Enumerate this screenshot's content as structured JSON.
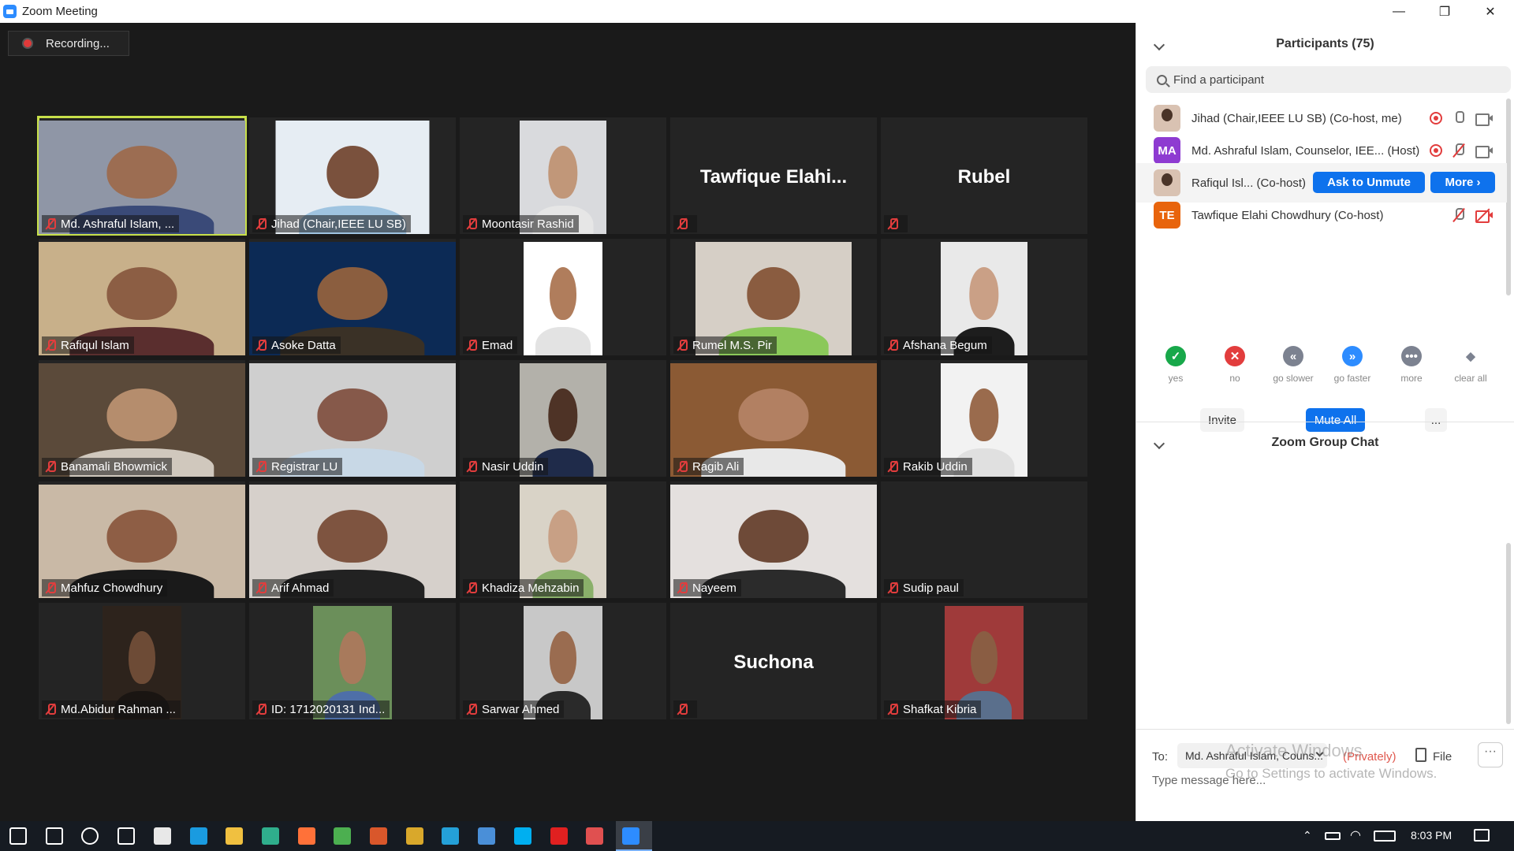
{
  "window": {
    "title": "Zoom Meeting",
    "minimize": "—",
    "maximize": "❐",
    "close": "✕"
  },
  "recording": {
    "label": "Recording..."
  },
  "tiles": [
    {
      "name": "Md. Ashraful Islam, ...",
      "bg": "#8f96a6",
      "skin": "#9c6d52",
      "shirt": "#3a4a78",
      "vw": 262,
      "active": true
    },
    {
      "name": "Jihad (Chair,IEEE LU SB)",
      "bg": "#e6edf3",
      "skin": "#7a513d",
      "shirt": "#9fc4e0",
      "vw": 195
    },
    {
      "name": "Moontasir Rashid",
      "bg": "#d9dadd",
      "skin": "#c19779",
      "shirt": "#e6e6e6",
      "vw": 110
    },
    {
      "name": "",
      "big": "Tawfique  Elahi..."
    },
    {
      "name": "",
      "big": "Rubel"
    },
    {
      "name": "Rafiqul Islam",
      "bg": "#c8b08a",
      "skin": "#8c5e44",
      "shirt": "#5a2e2e",
      "vw": 262
    },
    {
      "name": "Asoke Datta",
      "bg": "#0c2a55",
      "skin": "#8b5e3f",
      "shirt": "#3a3126",
      "vw": 262
    },
    {
      "name": "Emad",
      "bg": "#ffffff",
      "skin": "#b07d5c",
      "shirt": "#e3e3e3",
      "vw": 100
    },
    {
      "name": "Rumel M.S. Pir",
      "bg": "#d6cfc6",
      "skin": "#8a5c40",
      "shirt": "#8bc85a",
      "vw": 198
    },
    {
      "name": "Afshana Begum",
      "bg": "#e9e9e9",
      "skin": "#caa086",
      "shirt": "#1d1d1d",
      "vw": 110
    },
    {
      "name": "Banamali Bhowmick",
      "bg": "#5b4a3a",
      "skin": "#b58d6d",
      "shirt": "#d0c8bd",
      "vw": 262
    },
    {
      "name": "Registrar LU",
      "bg": "#cfcfcf",
      "skin": "#86594a",
      "shirt": "#c8d8e6",
      "vw": 262
    },
    {
      "name": "Nasir Uddin",
      "bg": "#b3b1aa",
      "skin": "#4e3326",
      "shirt": "#1f2b4a",
      "vw": 110
    },
    {
      "name": "Ragib Ali",
      "bg": "#8b5a34",
      "skin": "#b28062",
      "shirt": "#e8e8e8",
      "vw": 262
    },
    {
      "name": "Rakib Uddin",
      "bg": "#f2f2f2",
      "skin": "#9a6b4d",
      "shirt": "#e0e0e0",
      "vw": 110
    },
    {
      "name": "Mahfuz Chowdhury",
      "bg": "#c9b9a6",
      "skin": "#8e5e45",
      "shirt": "#1a1a1a",
      "vw": 262
    },
    {
      "name": "Arif Ahmad",
      "bg": "#d6d0cb",
      "skin": "#7e5440",
      "shirt": "#222222",
      "vw": 262
    },
    {
      "name": "Khadiza Mehzabin",
      "bg": "#d9d3c7",
      "skin": "#c8a085",
      "shirt": "#8ab06a",
      "vw": 110
    },
    {
      "name": "Nayeem",
      "bg": "#e4e0de",
      "skin": "#6e4a38",
      "shirt": "#2b2b2b",
      "vw": 262
    },
    {
      "name": "Sudip paul",
      "bg": "#242424",
      "skin": "#242424",
      "shirt": "#242424",
      "vw": 0
    },
    {
      "name": "Md.Abidur Rahman ...",
      "bg": "#2d231c",
      "skin": "#6d4b36",
      "shirt": "#1a1512",
      "vw": 100
    },
    {
      "name": "ID: 1712020131 Ind...",
      "bg": "#6b8f5a",
      "skin": "#a87a5c",
      "shirt": "#4e6fa8",
      "vw": 100
    },
    {
      "name": "Sarwar Ahmed",
      "bg": "#c8c8c8",
      "skin": "#9a6c50",
      "shirt": "#2a2a2a",
      "vw": 100
    },
    {
      "name": "",
      "big": "Suchona"
    },
    {
      "name": "Shafkat Kibria",
      "bg": "#9f3a3a",
      "skin": "#8a5d43",
      "shirt": "#5a6f8c",
      "vw": 100
    }
  ],
  "participants_panel": {
    "title": "Participants (75)",
    "search_placeholder": "Find a participant",
    "rows": [
      {
        "name": "Jihad (Chair,IEEE LU SB) (Co-host, me)",
        "avatar_type": "photo",
        "icons": [
          "record-icon",
          "mic-icon",
          "camera-icon"
        ]
      },
      {
        "name": "Md. Ashraful Islam, Counselor, IEE... (Host)",
        "avatar_type": "initials",
        "initials": "MA",
        "avatar_color": "#8e3bd1",
        "icons": [
          "record-icon",
          "mic-muted-icon",
          "camera-icon"
        ]
      },
      {
        "name": "Rafiqul Isl... (Co-host)",
        "avatar_type": "photo",
        "ask_to_unmute": "Ask to Unmute",
        "more": "More ›"
      },
      {
        "name": "Tawfique Elahi Chowdhury (Co-host)",
        "avatar_type": "initials",
        "initials": "TE",
        "avatar_color": "#e8640c",
        "icons": [
          "mic-muted-icon",
          "camera-off-icon"
        ]
      }
    ],
    "feedback": [
      {
        "label": "yes",
        "glyph": "✓",
        "color": "#18a84a"
      },
      {
        "label": "no",
        "glyph": "✕",
        "color": "#e23d3d"
      },
      {
        "label": "go slower",
        "glyph": "«",
        "color": "#7c8290"
      },
      {
        "label": "go faster",
        "glyph": "»",
        "color": "#2d8cff"
      },
      {
        "label": "more",
        "glyph": "•••",
        "color": "#7c8290"
      },
      {
        "label": "clear all",
        "glyph": "◆",
        "color": "#7c8290"
      }
    ],
    "buttons": {
      "invite": "Invite",
      "mute_all": "Mute All",
      "more": "..."
    }
  },
  "chat": {
    "title": "Zoom Group Chat",
    "to_label": "To:",
    "recipient": "Md. Ashraful Islam, Couns...",
    "privately": "(Privately)",
    "file_label": "File",
    "more": "···",
    "message_placeholder": "Type message here...",
    "watermark_line1": "Activate Windows",
    "watermark_line2": "Go to Settings to activate Windows."
  },
  "taskbar": {
    "time": "8:03 PM",
    "icons": [
      {
        "name": "start-icon",
        "color": "#ffffff"
      },
      {
        "name": "search-icon",
        "color": "#ffffff"
      },
      {
        "name": "cortana-icon",
        "color": "#ffffff"
      },
      {
        "name": "task-view-icon",
        "color": "#ffffff"
      },
      {
        "name": "store-icon",
        "color": "#e8e8e8"
      },
      {
        "name": "edge-icon",
        "color": "#1a9be0"
      },
      {
        "name": "file-explorer-icon",
        "color": "#f0c040"
      },
      {
        "name": "photo-editor-icon",
        "color": "#2fae8c"
      },
      {
        "name": "firefox-icon",
        "color": "#ff7139"
      },
      {
        "name": "chrome-icon",
        "color": "#4caf50"
      },
      {
        "name": "powerpoint-icon",
        "color": "#d9572b"
      },
      {
        "name": "app-icon",
        "color": "#d9a82b"
      },
      {
        "name": "edge-legacy-icon",
        "color": "#24a0d8"
      },
      {
        "name": "mail-icon",
        "color": "#4a8fd8"
      },
      {
        "name": "skype-icon",
        "color": "#00aff0"
      },
      {
        "name": "acrobat-icon",
        "color": "#e02020"
      },
      {
        "name": "snipping-icon",
        "color": "#e05050"
      },
      {
        "name": "zoom-icon",
        "color": "#2d8cff"
      }
    ]
  }
}
